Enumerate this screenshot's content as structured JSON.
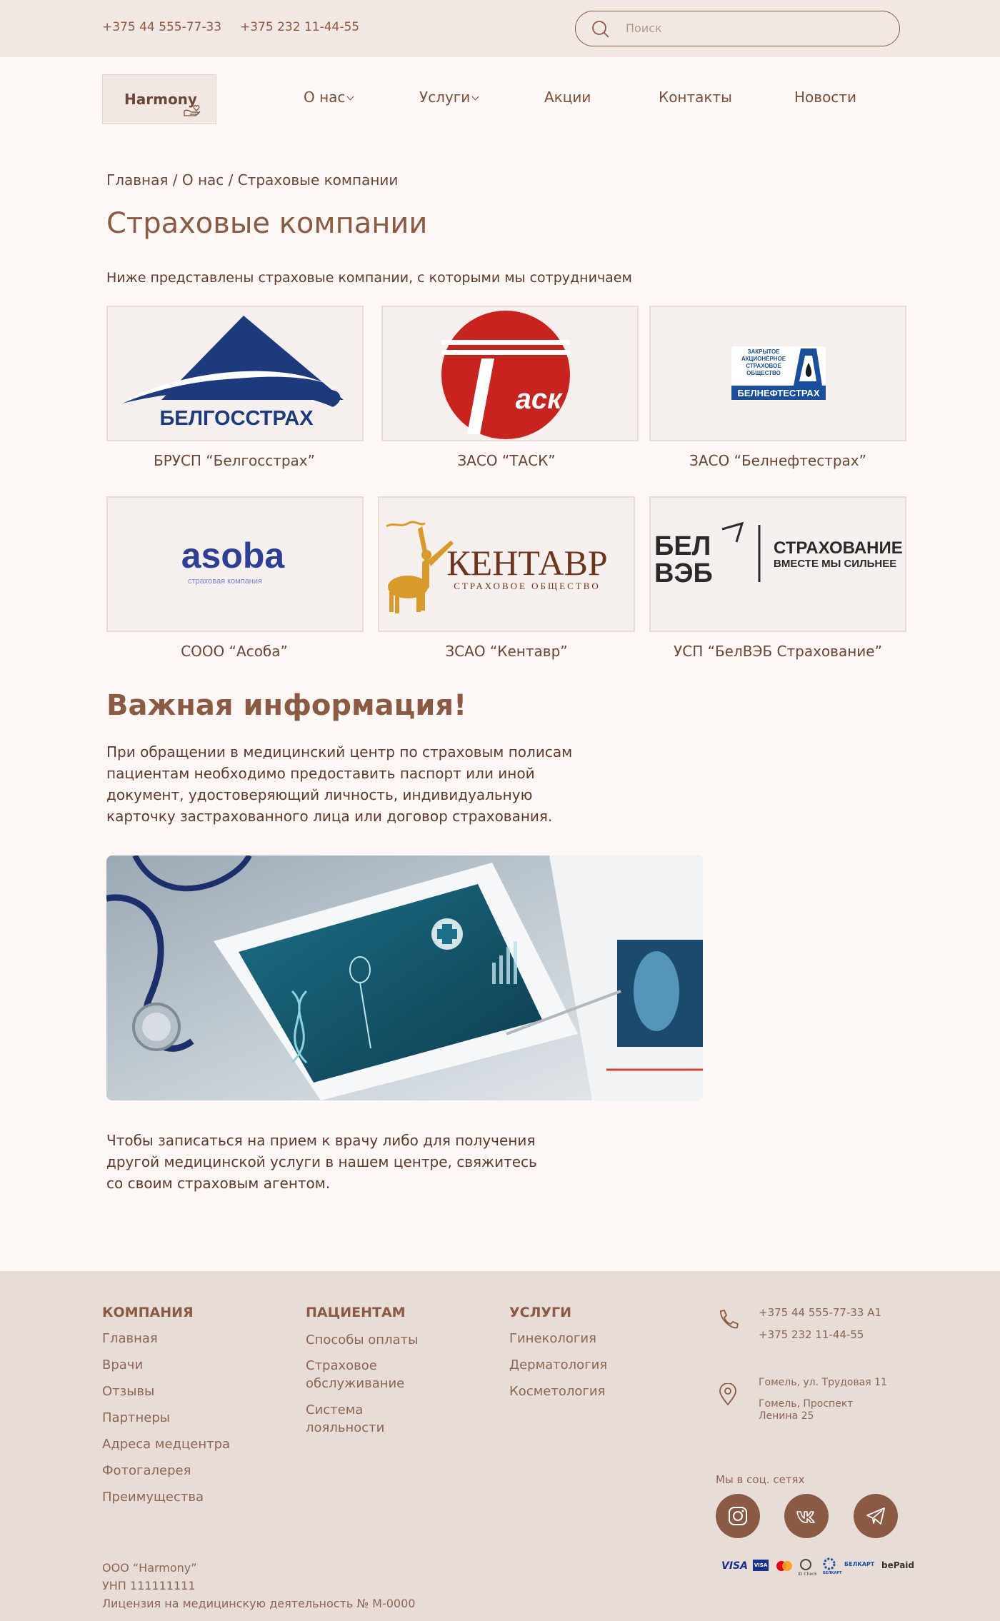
{
  "header": {
    "phone1": "+375 44 555-77-33",
    "phone2": "+375 232 11-44-55",
    "search_placeholder": "Поиск"
  },
  "nav": {
    "logo": "Harmony",
    "items": [
      {
        "label": "О нас"
      },
      {
        "label": "Услуги"
      },
      {
        "label": "Акции"
      },
      {
        "label": "Контакты"
      },
      {
        "label": "Новости"
      }
    ]
  },
  "main": {
    "breadcrumb": "Главная / О нас / Страховые компании",
    "title": "Страховые компании",
    "intro": "Ниже представлены страховые компании, с которыми мы сотрудничаем",
    "companies": [
      {
        "label": "БРУСП “Белгосстрах”",
        "logo_text": "БЕЛГОССТРАХ",
        "color": "#1d3a7d"
      },
      {
        "label": "ЗАСО “ТАСК”",
        "logo_text": "Таск",
        "color": "#c8231f"
      },
      {
        "label": "ЗАСО “Белнефтестрах”",
        "logo_text": "БЕЛНЕФТЕСТРАХ",
        "logo_small": [
          "ЗАКРЫТОЕ",
          "АКЦИОНЕРНОЕ",
          "СТРАХОВОЕ",
          "ОБЩЕСТВО"
        ],
        "color": "#1a4fa0"
      },
      {
        "label": "СООО “Асоба”",
        "logo_text": "asoba",
        "logo_small": [
          "страховая компания"
        ],
        "color": "#2f3f94"
      },
      {
        "label": "ЗСАО “Кентавр”",
        "logo_text": "КЕНТАВР",
        "logo_small": [
          "СТРАХОВОЕ ОБЩЕСТВО"
        ],
        "color": "#6b3520"
      },
      {
        "label": "УСП “БелВЭБ Страхование”",
        "logo_text": "БЕЛ",
        "logo_text2": "ВЭБ",
        "logo_small": [
          "СТРАХОВАНИЕ",
          "ВМЕСТЕ МЫ СИЛЬНЕЕ"
        ],
        "color": "#2a2a2a"
      }
    ],
    "important_title": "Важная информация!",
    "important_lines": [
      "При обращении в медицинский центр по страховым полисам",
      "пациентам необходимо предоставить паспорт или иной",
      "документ, удостоверяющий личность, индивидуальную",
      "карточку застрахованного лица или договор страхования."
    ],
    "outro_lines": [
      "Чтобы записаться на прием к врачу либо для получения",
      "другой медицинской услуги в нашем центре, свяжитесь",
      "со своим страховым агентом."
    ]
  },
  "footer": {
    "company": {
      "title": "КОМПАНИЯ",
      "links": [
        "Главная",
        "Врачи",
        "Отзывы",
        "Партнеры",
        "Адреса медцентра",
        "Фотогалерея",
        "Преимущества"
      ]
    },
    "patients": {
      "title": "ПАЦИЕНТАМ",
      "links": [
        [
          "Способы оплаты"
        ],
        [
          "Страховое",
          "обслуживание"
        ],
        [
          "Система",
          "лояльности"
        ]
      ]
    },
    "services": {
      "title": "УСЛУГИ",
      "links": [
        "Гинекология",
        "Дерматология",
        "Косметология"
      ]
    },
    "contacts": {
      "phone1": "+375 44 555-77-33 А1",
      "phone2": "+375 232 11-44-55",
      "address1": "Гомель, ул. Трудовая 11",
      "address2_lines": [
        "Гомель, Проспект",
        "Ленина 25"
      ]
    },
    "social_title": "Мы в соц. сетях",
    "legal": [
      "ООО “Harmony”",
      "УНП 111111111",
      "Лицензия на медицинскую деятельность № М-0000"
    ],
    "payments": [
      "VISA",
      "VISA",
      "MC",
      "ID Check",
      "БЕЛКАРТ",
      "БЕЛКАРТ",
      "bePaid"
    ]
  }
}
